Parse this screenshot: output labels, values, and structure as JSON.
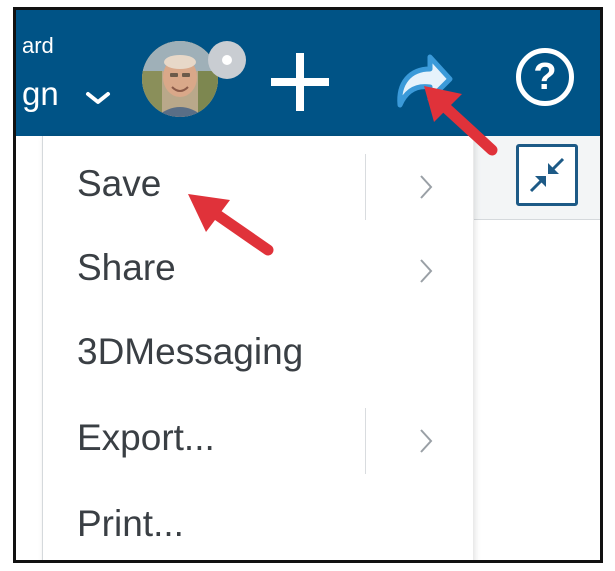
{
  "header": {
    "context_sub": "ard",
    "context_main": "gn",
    "help_label": "?"
  },
  "menu": {
    "items": [
      {
        "label": "Save",
        "has_submenu": true
      },
      {
        "label": "Share",
        "has_submenu": true
      },
      {
        "label": "3DMessaging",
        "has_submenu": false
      },
      {
        "label": "Export...",
        "has_submenu": true
      },
      {
        "label": "Print...",
        "has_submenu": false
      }
    ]
  },
  "icons": {
    "avatar": "user-avatar",
    "badge": "status-badge",
    "add": "plus-icon",
    "share": "share-arrow-icon",
    "help": "help-icon",
    "compress": "compress-icon"
  },
  "colors": {
    "topbar": "#005386",
    "menu_text": "#3a3f44",
    "annotation_arrow": "#e0323a",
    "share_icon": "#3b9ad9"
  }
}
